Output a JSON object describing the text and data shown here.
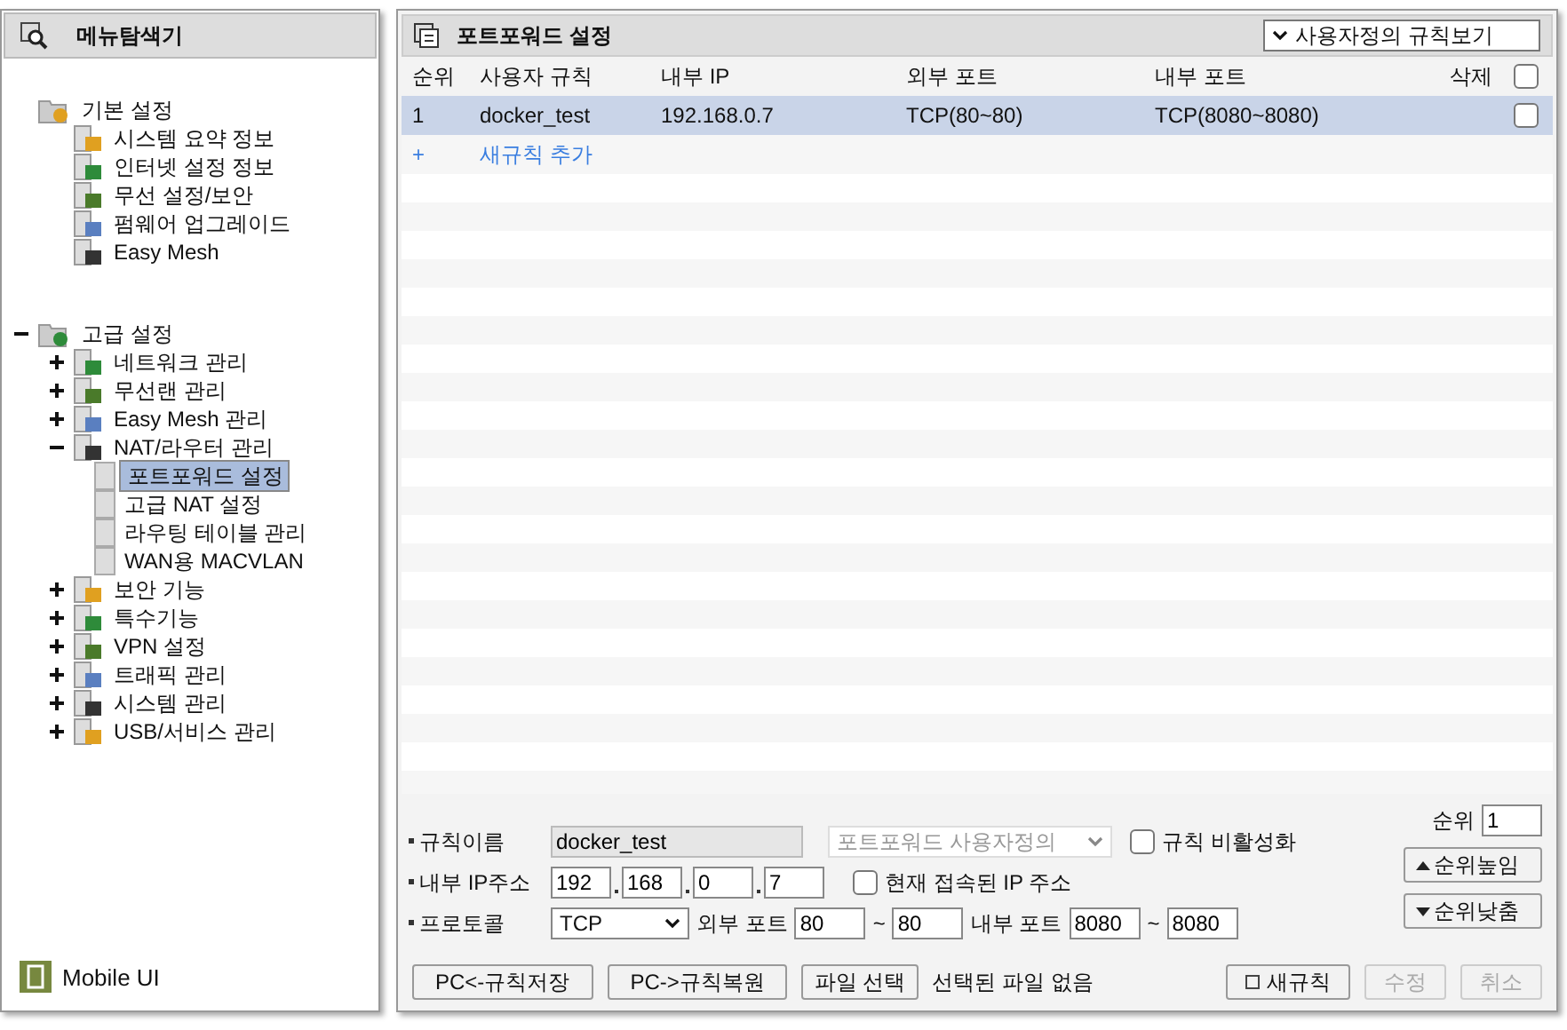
{
  "sidebar": {
    "title": "메뉴탐색기",
    "groups": [
      {
        "label": "기본 설정",
        "children": [
          {
            "label": "시스템 요약 정보",
            "selected": false
          },
          {
            "label": "인터넷 설정 정보",
            "selected": false
          },
          {
            "label": "무선 설정/보안",
            "selected": false
          },
          {
            "label": "펌웨어 업그레이드",
            "selected": false
          },
          {
            "label": "Easy Mesh",
            "selected": false
          }
        ]
      },
      {
        "label": "고급 설정",
        "expanded": true,
        "children": [
          {
            "label": "네트워크 관리",
            "expanded": false
          },
          {
            "label": "무선랜 관리",
            "expanded": false
          },
          {
            "label": "Easy Mesh 관리",
            "expanded": false
          },
          {
            "label": "NAT/라우터 관리",
            "expanded": true,
            "children": [
              {
                "label": "포트포워드 설정",
                "selected": true
              },
              {
                "label": "고급 NAT 설정",
                "selected": false
              },
              {
                "label": "라우팅 테이블 관리",
                "selected": false
              },
              {
                "label": "WAN용 MACVLAN",
                "selected": false
              }
            ]
          },
          {
            "label": "보안 기능",
            "expanded": false
          },
          {
            "label": "특수기능",
            "expanded": false
          },
          {
            "label": "VPN 설정",
            "expanded": false
          },
          {
            "label": "트래픽 관리",
            "expanded": false
          },
          {
            "label": "시스템 관리",
            "expanded": false
          },
          {
            "label": "USB/서비스 관리",
            "expanded": false
          }
        ]
      }
    ],
    "footer": "Mobile UI"
  },
  "panel": {
    "title": "포트포워드 설정",
    "view_select": "사용자정의 규칙보기"
  },
  "table": {
    "columns": [
      "순위",
      "사용자 규칙",
      "내부 IP",
      "외부 포트",
      "내부 포트",
      "삭제"
    ],
    "delete_all_checked": false,
    "rows": [
      {
        "cells": [
          "1",
          "docker_test",
          "192.168.0.7",
          "TCP(80~80)",
          "TCP(8080~8080)"
        ],
        "selected": true,
        "checked": false
      }
    ],
    "add_row": {
      "icon": "+",
      "label": "새규칙 추가"
    }
  },
  "form": {
    "name_label": "규칙이름",
    "name_value": "docker_test",
    "preset": "포트포워드 사용자정의",
    "disable_label": "규칙 비활성화",
    "disable_checked": false,
    "ip_label": "내부 IP주소",
    "ip": [
      "192",
      "168",
      "0",
      "7"
    ],
    "current_ip_label": "현재 접속된 IP 주소",
    "current_ip_checked": false,
    "protocol_label": "프로토콜",
    "protocol": "TCP",
    "ext_label": "외부 포트",
    "ext_from": "80",
    "ext_to": "80",
    "int_label": "내부 포트",
    "int_from": "8080",
    "int_to": "8080",
    "tilde": "~",
    "rank_label": "순위",
    "rank_value": "1",
    "up_button": "순위높임",
    "down_button": "순위낮춤"
  },
  "buttons": {
    "save": "PC<-규칙저장",
    "restore": "PC->규칙복원",
    "file": "파일 선택",
    "file_status": "선택된 파일 없음",
    "new": "새규칙",
    "edit": {
      "label": "수정",
      "disabled": true
    },
    "cancel": {
      "label": "취소",
      "disabled": true
    }
  }
}
